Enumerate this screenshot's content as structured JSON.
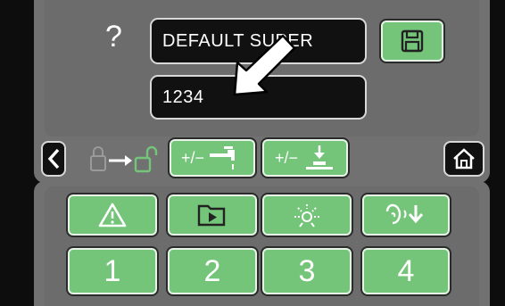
{
  "header": {
    "help_symbol": "?"
  },
  "fields": {
    "program_name": "DEFAULT SUPER",
    "code": "1234"
  },
  "buttons": {
    "save": "save-floppy-icon",
    "back": "chevron-left-icon",
    "home": "home-icon",
    "lock_state": "lock-to-unlock-icon",
    "water_adjust": "+/−",
    "height_adjust": "+/−",
    "numbers": [
      "1",
      "2",
      "3",
      "4"
    ]
  },
  "icon_buttons": [
    {
      "name": "warning-icon"
    },
    {
      "name": "folder-play-icon"
    },
    {
      "name": "light-icon"
    },
    {
      "name": "ear-sound-icon"
    }
  ],
  "colors": {
    "accent_green": "#74c57a",
    "panel_gray": "#6f6f6f",
    "background": "#0d0d0d"
  }
}
